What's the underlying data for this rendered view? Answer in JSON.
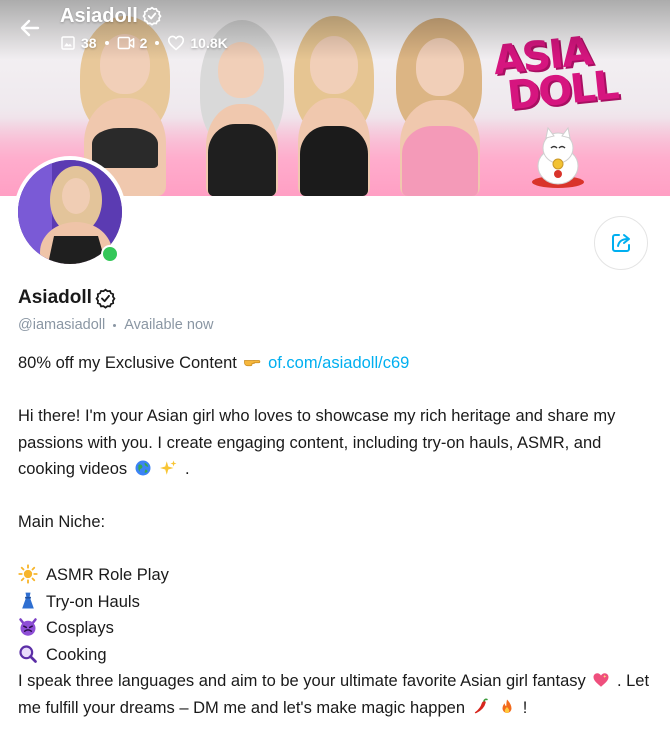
{
  "header": {
    "display_name": "Asiadoll",
    "stats": {
      "photos": "38",
      "videos": "2",
      "likes": "10.8K"
    }
  },
  "banner": {
    "logo_text": "ASIA DOLL"
  },
  "profile": {
    "display_name": "Asiadoll",
    "handle": "@iamasiadoll",
    "availability": "Available now"
  },
  "bio": {
    "promo_text": "80% off my Exclusive Content",
    "promo_link": "of.com/asiadoll/c69",
    "intro": "Hi there! I'm your Asian girl who loves to showcase my rich heritage and share my passions with you. I create engaging content, including try-on hauls, ASMR, and cooking videos",
    "intro_end": ".",
    "niche_heading": "Main Niche:",
    "niches": [
      {
        "label": "ASMR Role Play",
        "icon": "sun-icon"
      },
      {
        "label": "Try-on Hauls",
        "icon": "dress-icon"
      },
      {
        "label": "Cosplays",
        "icon": "devil-face-icon"
      },
      {
        "label": "Cooking",
        "icon": "magnifier-icon"
      }
    ],
    "closing_1": "I speak three languages and aim to be your ultimate favorite Asian girl fantasy",
    "closing_2": ". Let me fulfill your dreams – DM me and let's make magic happen",
    "closing_3": "!"
  },
  "colors": {
    "accent": "#00aff0",
    "muted": "#8a96a3",
    "online": "#34c759",
    "logo_pink": "#d6157f"
  }
}
